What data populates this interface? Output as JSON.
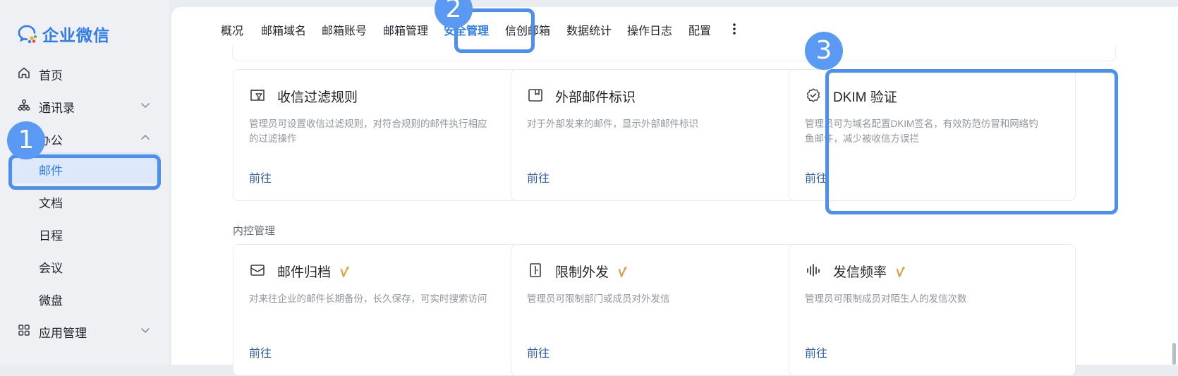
{
  "app": {
    "logo_text": "企业微信"
  },
  "sidebar": {
    "items": [
      {
        "label": "首页",
        "icon": "home-icon"
      },
      {
        "label": "通讯录",
        "icon": "org-chart-icon",
        "expanded": false
      },
      {
        "label": "办公",
        "icon": "office-icon",
        "expanded": true
      },
      {
        "label": "邮件",
        "active": true
      },
      {
        "label": "文档"
      },
      {
        "label": "日程"
      },
      {
        "label": "会议"
      },
      {
        "label": "微盘"
      },
      {
        "label": "应用管理",
        "icon": "apps-grid-icon",
        "expanded": false
      }
    ]
  },
  "tabs": [
    {
      "label": "概况"
    },
    {
      "label": "邮箱域名"
    },
    {
      "label": "邮箱账号"
    },
    {
      "label": "邮箱管理"
    },
    {
      "label": "安全管理",
      "active": true
    },
    {
      "label": "信创邮箱"
    },
    {
      "label": "数据统计"
    },
    {
      "label": "操作日志"
    },
    {
      "label": "配置"
    }
  ],
  "cards_top": [
    {
      "title": "收信过滤规则",
      "desc": "管理员可设置收信过滤规则，对符合规则的邮件执行相应的过滤操作",
      "link": "前往",
      "icon": "inbox-filter-icon"
    },
    {
      "title": "外部邮件标识",
      "desc": "对于外部发来的邮件，显示外部邮件标识",
      "link": "前往",
      "icon": "external-tag-icon"
    },
    {
      "title": "DKIM 验证",
      "desc": "管理员可为域名配置DKIM签名，有效防范仿冒和网络钓鱼邮件，减少被收信方误拦",
      "link": "前往",
      "icon": "verified-badge-icon"
    }
  ],
  "section_internal": "内控管理",
  "cards_bottom": [
    {
      "title": "邮件归档",
      "desc": "对来往企业的邮件长期备份，长久保存，可实时搜索访问",
      "link": "前往",
      "icon": "mail-archive-icon",
      "premium": true
    },
    {
      "title": "限制外发",
      "desc": "管理员可限制部门或成员对外发信",
      "link": "前往",
      "icon": "door-exit-icon",
      "premium": true
    },
    {
      "title": "发信频率",
      "desc": "管理员可限制成员对陌生人的发信次数",
      "link": "前往",
      "icon": "frequency-bars-icon",
      "premium": true
    }
  ],
  "annotations": [
    "1",
    "2",
    "3"
  ],
  "colors": {
    "accent": "#2f7bf0",
    "highlight": "#4b8ff2",
    "badge": "#5a9af5",
    "premium_gold": "#d9a441"
  }
}
